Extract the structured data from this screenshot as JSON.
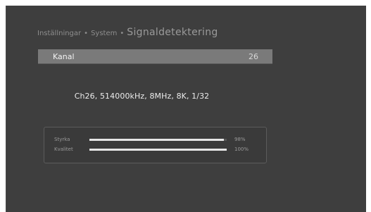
{
  "breadcrumb": {
    "level1": "Inställningar",
    "sep1": "•",
    "level2": "System",
    "sep2": "•",
    "current": "Signaldetektering"
  },
  "channel": {
    "label": "Kanal",
    "value": "26"
  },
  "info": "Ch26, 514000kHz, 8MHz, 8K, 1/32",
  "meters": [
    {
      "label": "Styrka",
      "percent_text": "98%",
      "level": 0.98
    },
    {
      "label": "Kvalitet",
      "percent_text": "100%",
      "level": 1.0
    }
  ],
  "colors": {
    "screen_bg": "#3e3e3e",
    "highlight_bar": "#7a7a7a",
    "meter_fill": "#e6e6e6"
  }
}
